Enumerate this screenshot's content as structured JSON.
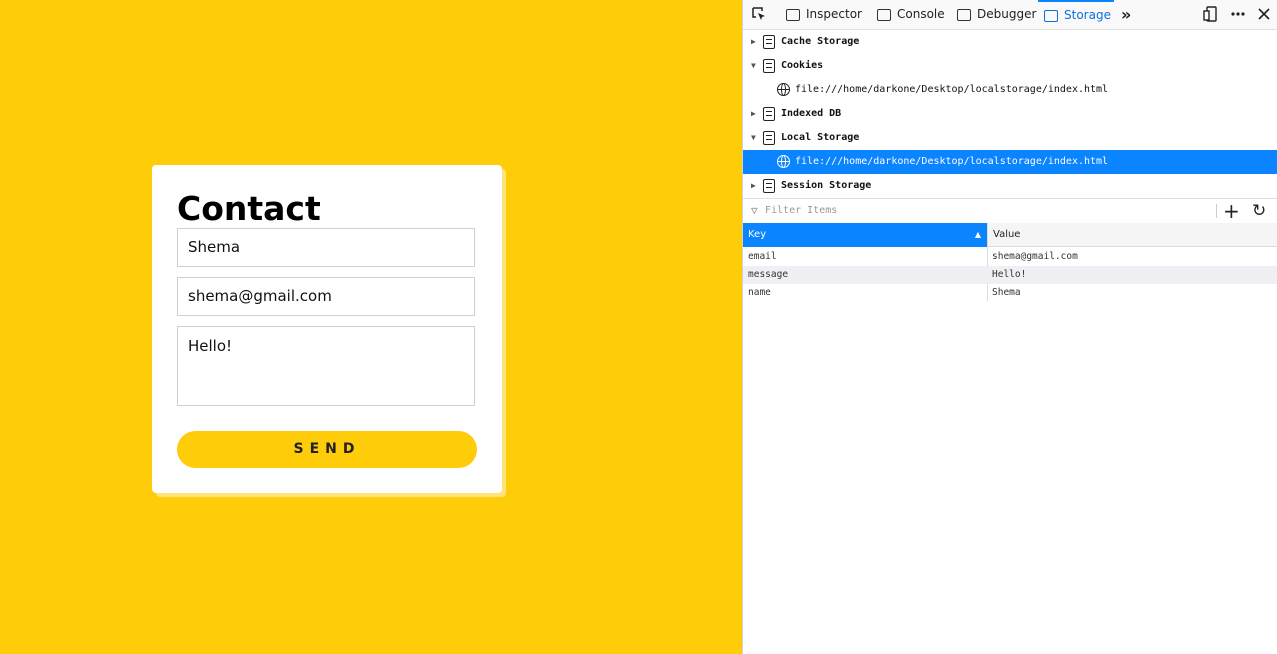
{
  "contact": {
    "title": "Contact",
    "name_value": "Shema",
    "email_value": "shema@gmail.com",
    "message_value": "Hello!",
    "send_label": "SEND"
  },
  "devtools": {
    "tabs": [
      {
        "label": "Inspector",
        "icon": "inspector-icon"
      },
      {
        "label": "Console",
        "icon": "console-icon"
      },
      {
        "label": "Debugger",
        "icon": "debugger-icon"
      },
      {
        "label": "Storage",
        "icon": "storage-icon",
        "active": true
      }
    ],
    "tree": [
      {
        "label": "Cache Storage",
        "expanded": false
      },
      {
        "label": "Cookies",
        "expanded": true
      },
      {
        "label": "file:///home/darkone/Desktop/localstorage/index.html",
        "child": true
      },
      {
        "label": "Indexed DB",
        "expanded": false
      },
      {
        "label": "Local Storage",
        "expanded": true
      },
      {
        "label": "file:///home/darkone/Desktop/localstorage/index.html",
        "child": true,
        "selected": true
      },
      {
        "label": "Session Storage",
        "expanded": false
      }
    ],
    "filter_placeholder": "Filter Items",
    "columns": {
      "key": "Key",
      "value": "Value"
    },
    "rows": [
      {
        "key": "email",
        "value": "shema@gmail.com"
      },
      {
        "key": "message",
        "value": "Hello!"
      },
      {
        "key": "name",
        "value": "Shema"
      }
    ],
    "colors": {
      "accent": "#0a84ff",
      "page_bg": "#FFCC0A"
    }
  }
}
